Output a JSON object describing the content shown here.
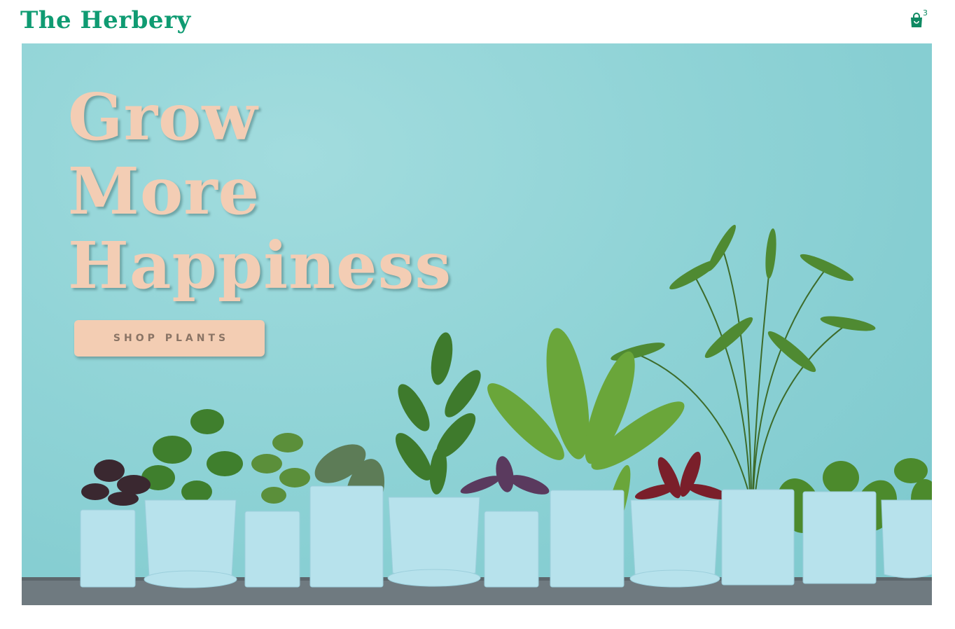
{
  "brand": {
    "name": "The Herbery",
    "color": "#0f9b72"
  },
  "header": {
    "cart_icon": "shopping-bag-icon",
    "cart_count": "3"
  },
  "hero": {
    "headline": [
      "Grow",
      "More",
      "Happiness"
    ],
    "cta_label": "SHOP PLANTS",
    "image": "potted-plants-row-photo",
    "background_color": "#8fd3d6",
    "accent_color": "#f3cdb4"
  }
}
